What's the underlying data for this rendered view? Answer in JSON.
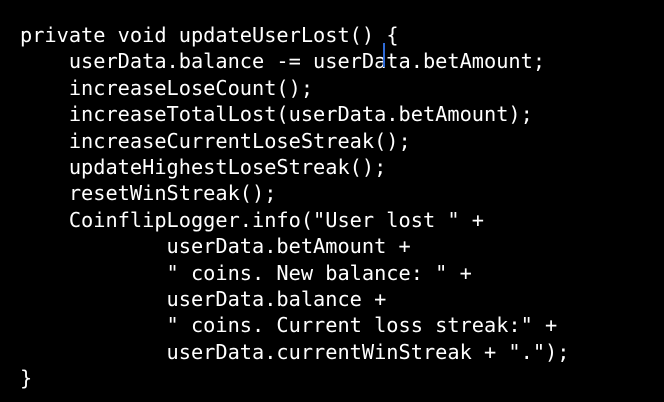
{
  "editor": {
    "lines": [
      "private void updateUserLost() {",
      "    userData.balance -= userData.betAmount;",
      "    increaseLoseCount();",
      "    increaseTotalLost(userData.betAmount);",
      "    increaseCurrentLoseStreak();",
      "    updateHighestLoseStreak();",
      "    resetWinStreak();",
      "    CoinflipLogger.info(\"User lost \" +",
      "            userData.betAmount +",
      "            \" coins. New balance: \" +",
      "            userData.balance +",
      "            \" coins. Current loss streak:\" +",
      "            userData.currentWinStreak + \".\");",
      "}"
    ],
    "line0_prefix": "private void updateUserLost() ",
    "line0_brace": "{",
    "colors": {
      "background": "#000000",
      "text": "#ffffff",
      "caret": "#2f6bd8"
    }
  }
}
